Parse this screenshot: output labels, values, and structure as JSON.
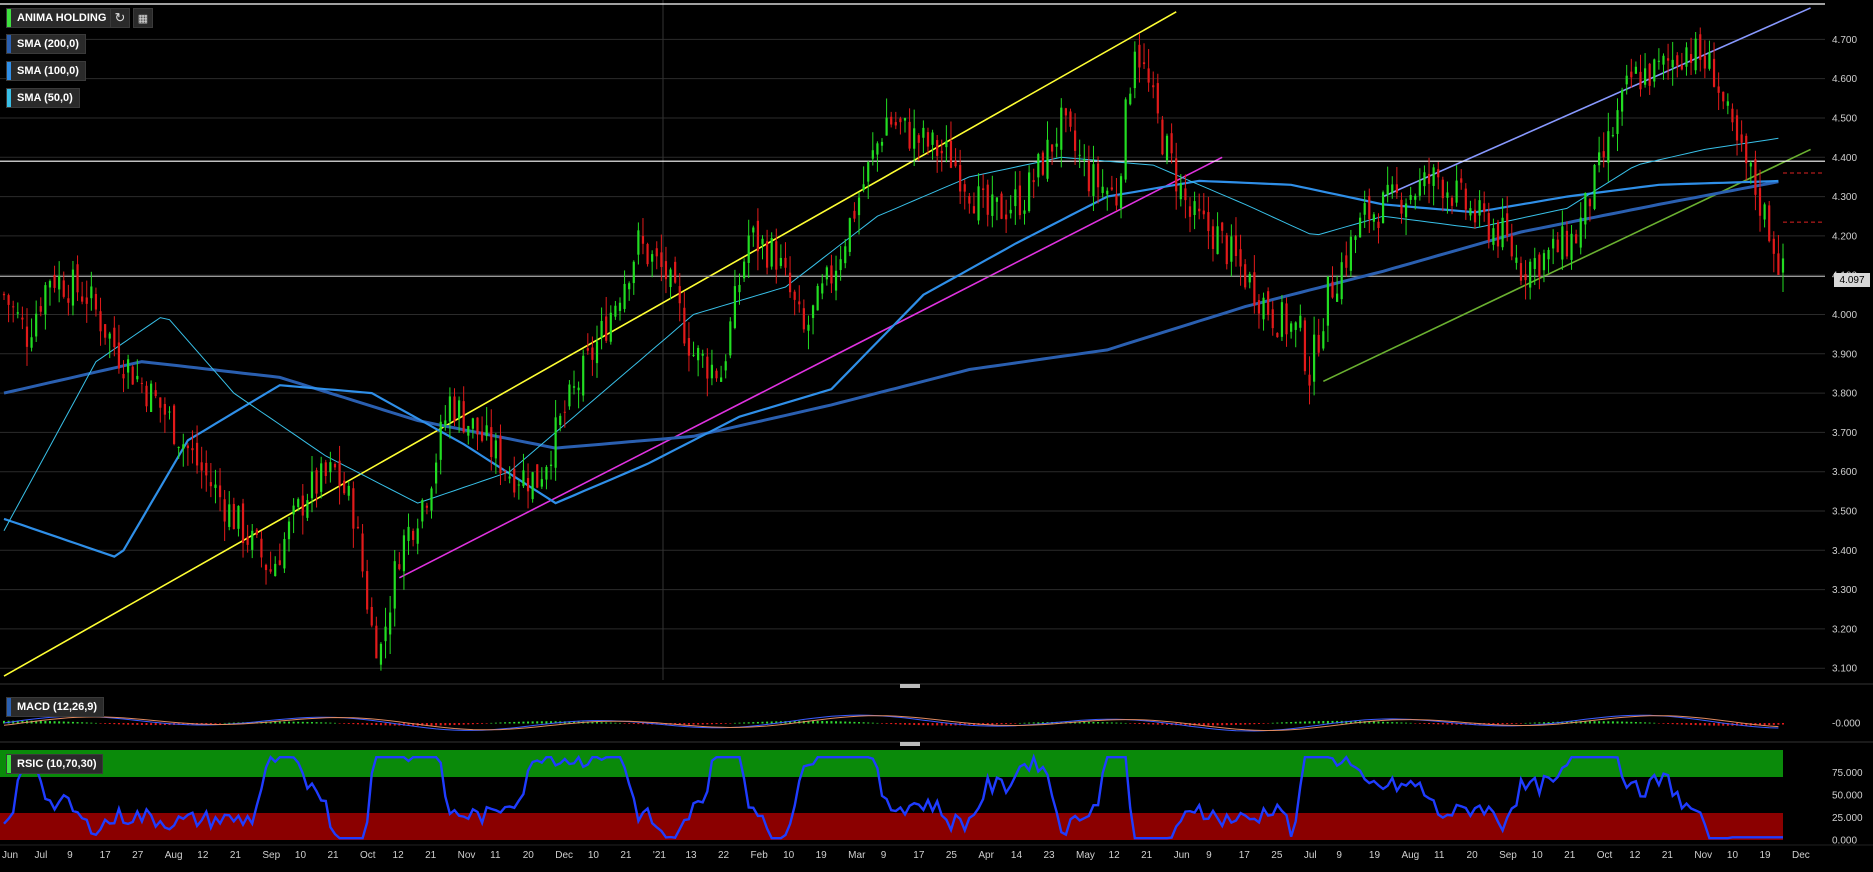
{
  "toolbar": {
    "symbol": "ANIMA HOLDING",
    "refresh_icon": "refresh-icon",
    "calendar_icon": "calendar-icon"
  },
  "indicators": [
    {
      "label": "SMA (200,0)",
      "color": "#2a5fb0"
    },
    {
      "label": "SMA (100,0)",
      "color": "#2f8fe8"
    },
    {
      "label": "SMA (50,0)",
      "color": "#38c0e8"
    }
  ],
  "macd": {
    "label": "MACD (12,26,9)",
    "tick": "-0.000"
  },
  "rsi": {
    "label": "RSIC (10,70,30)",
    "ticks": [
      "75.000",
      "50.000",
      "25.000",
      "0.000"
    ]
  },
  "last_price": "4.097",
  "chart_data": {
    "type": "candlestick",
    "ylim": [
      3.07,
      4.79
    ],
    "y_ticks": [
      "4.700",
      "4.600",
      "4.500",
      "4.400",
      "4.300",
      "4.200",
      "4.100",
      "4.000",
      "3.900",
      "3.800",
      "3.700",
      "3.600",
      "3.500",
      "3.400",
      "3.300",
      "3.200",
      "3.100"
    ],
    "x_labels": [
      "Jun",
      "Jul",
      "9",
      "17",
      "27",
      "Aug",
      "12",
      "21",
      "Sep",
      "10",
      "21",
      "Oct",
      "12",
      "21",
      "Nov",
      "11",
      "20",
      "Dec",
      "10",
      "21",
      "'21",
      "13",
      "22",
      "Feb",
      "10",
      "19",
      "Mar",
      "9",
      "17",
      "25",
      "Apr",
      "14",
      "23",
      "May",
      "12",
      "21",
      "Jun",
      "9",
      "17",
      "25",
      "Jul",
      "9",
      "19",
      "Aug",
      "11",
      "20",
      "Sep",
      "10",
      "21",
      "Oct",
      "12",
      "21",
      "Nov",
      "10",
      "19",
      "Dec"
    ],
    "close_waypoints": [
      [
        0,
        4.05
      ],
      [
        5,
        3.95
      ],
      [
        10,
        4.1
      ],
      [
        18,
        4.05
      ],
      [
        25,
        3.9
      ],
      [
        35,
        3.75
      ],
      [
        42,
        3.62
      ],
      [
        52,
        3.45
      ],
      [
        58,
        3.35
      ],
      [
        66,
        3.55
      ],
      [
        72,
        3.6
      ],
      [
        76,
        3.5
      ],
      [
        80,
        3.2
      ],
      [
        82,
        3.15
      ],
      [
        86,
        3.4
      ],
      [
        92,
        3.55
      ],
      [
        97,
        3.78
      ],
      [
        103,
        3.7
      ],
      [
        110,
        3.6
      ],
      [
        116,
        3.58
      ],
      [
        122,
        3.75
      ],
      [
        130,
        3.95
      ],
      [
        138,
        4.18
      ],
      [
        144,
        4.1
      ],
      [
        150,
        3.9
      ],
      [
        156,
        3.85
      ],
      [
        162,
        4.2
      ],
      [
        168,
        4.15
      ],
      [
        174,
        3.95
      ],
      [
        180,
        4.1
      ],
      [
        186,
        4.3
      ],
      [
        192,
        4.5
      ],
      [
        198,
        4.45
      ],
      [
        206,
        4.4
      ],
      [
        214,
        4.25
      ],
      [
        222,
        4.3
      ],
      [
        230,
        4.48
      ],
      [
        236,
        4.35
      ],
      [
        242,
        4.3
      ],
      [
        246,
        4.7
      ],
      [
        252,
        4.45
      ],
      [
        258,
        4.25
      ],
      [
        264,
        4.2
      ],
      [
        270,
        4.1
      ],
      [
        276,
        4.0
      ],
      [
        282,
        3.95
      ],
      [
        284,
        3.85
      ],
      [
        288,
        4.05
      ],
      [
        296,
        4.25
      ],
      [
        304,
        4.3
      ],
      [
        312,
        4.35
      ],
      [
        320,
        4.25
      ],
      [
        326,
        4.2
      ],
      [
        330,
        4.12
      ],
      [
        336,
        4.15
      ],
      [
        342,
        4.2
      ],
      [
        348,
        4.4
      ],
      [
        354,
        4.6
      ],
      [
        360,
        4.62
      ],
      [
        366,
        4.68
      ],
      [
        372,
        4.62
      ],
      [
        376,
        4.45
      ],
      [
        380,
        4.35
      ],
      [
        384,
        4.22
      ],
      [
        387,
        4.1
      ]
    ],
    "sma_200_waypoints": [
      [
        0,
        3.8
      ],
      [
        30,
        3.88
      ],
      [
        60,
        3.84
      ],
      [
        90,
        3.73
      ],
      [
        120,
        3.66
      ],
      [
        150,
        3.69
      ],
      [
        180,
        3.77
      ],
      [
        210,
        3.86
      ],
      [
        240,
        3.91
      ],
      [
        270,
        4.02
      ],
      [
        300,
        4.11
      ],
      [
        330,
        4.21
      ],
      [
        360,
        4.28
      ],
      [
        387,
        4.34
      ]
    ],
    "sma_100_waypoints": [
      [
        0,
        3.48
      ],
      [
        25,
        3.38
      ],
      [
        40,
        3.68
      ],
      [
        60,
        3.82
      ],
      [
        80,
        3.8
      ],
      [
        100,
        3.67
      ],
      [
        120,
        3.52
      ],
      [
        140,
        3.62
      ],
      [
        160,
        3.74
      ],
      [
        180,
        3.81
      ],
      [
        200,
        4.05
      ],
      [
        220,
        4.18
      ],
      [
        240,
        4.3
      ],
      [
        260,
        4.34
      ],
      [
        280,
        4.33
      ],
      [
        300,
        4.28
      ],
      [
        320,
        4.26
      ],
      [
        340,
        4.3
      ],
      [
        360,
        4.33
      ],
      [
        387,
        4.34
      ]
    ],
    "sma_50_waypoints": [
      [
        0,
        3.45
      ],
      [
        20,
        3.88
      ],
      [
        35,
        4.0
      ],
      [
        50,
        3.8
      ],
      [
        70,
        3.64
      ],
      [
        90,
        3.52
      ],
      [
        110,
        3.6
      ],
      [
        130,
        3.8
      ],
      [
        150,
        4.0
      ],
      [
        170,
        4.07
      ],
      [
        190,
        4.25
      ],
      [
        210,
        4.35
      ],
      [
        230,
        4.4
      ],
      [
        250,
        4.38
      ],
      [
        270,
        4.28
      ],
      [
        285,
        4.2
      ],
      [
        300,
        4.25
      ],
      [
        320,
        4.22
      ],
      [
        340,
        4.27
      ],
      [
        355,
        4.38
      ],
      [
        370,
        4.42
      ],
      [
        387,
        4.45
      ]
    ],
    "n_bars": 388,
    "trendlines": [
      {
        "color": "#ffff33",
        "from": [
          0,
          3.08
        ],
        "to": [
          255,
          4.77
        ]
      },
      {
        "color": "#e032e0",
        "from": [
          86,
          3.33
        ],
        "to": [
          265,
          4.4
        ]
      },
      {
        "color": "#8899ff",
        "from": [
          300,
          4.3
        ],
        "to": [
          393,
          4.78
        ]
      },
      {
        "color": "#6ab030",
        "from": [
          287,
          3.83
        ],
        "to": [
          393,
          4.42
        ]
      }
    ],
    "horizontal_lines": [
      {
        "color": "#ffffff",
        "value": 4.79
      },
      {
        "color": "#ffffff",
        "value": 4.39
      },
      {
        "color": "#999999",
        "value": 4.097
      }
    ],
    "rsi_zones": {
      "upper": [
        70,
        100
      ],
      "lower": [
        0,
        30
      ]
    }
  }
}
